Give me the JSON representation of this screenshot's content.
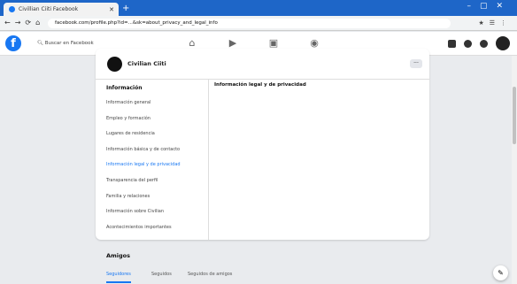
{
  "browser": {
    "tab_title": "Civillian Ciiti Facebook",
    "url": "facebook.com/profile.php?id=...&sk=about_privacy_and_legal_info"
  },
  "header": {
    "search_placeholder": "Buscar en Facebook"
  },
  "profile": {
    "name": "Civilian Ciiti"
  },
  "sidebar": {
    "title": "Información",
    "items": [
      {
        "label": "Información general"
      },
      {
        "label": "Empleo y formación"
      },
      {
        "label": "Lugares de residencia"
      },
      {
        "label": "Información básica y de contacto"
      },
      {
        "label": "Información legal y de privacidad"
      },
      {
        "label": "Transparencia del perfil"
      },
      {
        "label": "Familia y relaciones"
      },
      {
        "label": "Información sobre Civilian"
      },
      {
        "label": "Acontecimientos importantes"
      }
    ]
  },
  "content": {
    "title": "Información legal y de privacidad"
  },
  "friends": {
    "title": "Amigos",
    "tabs": [
      "Seguidores",
      "Seguidos",
      "Seguidos de amigos"
    ]
  }
}
